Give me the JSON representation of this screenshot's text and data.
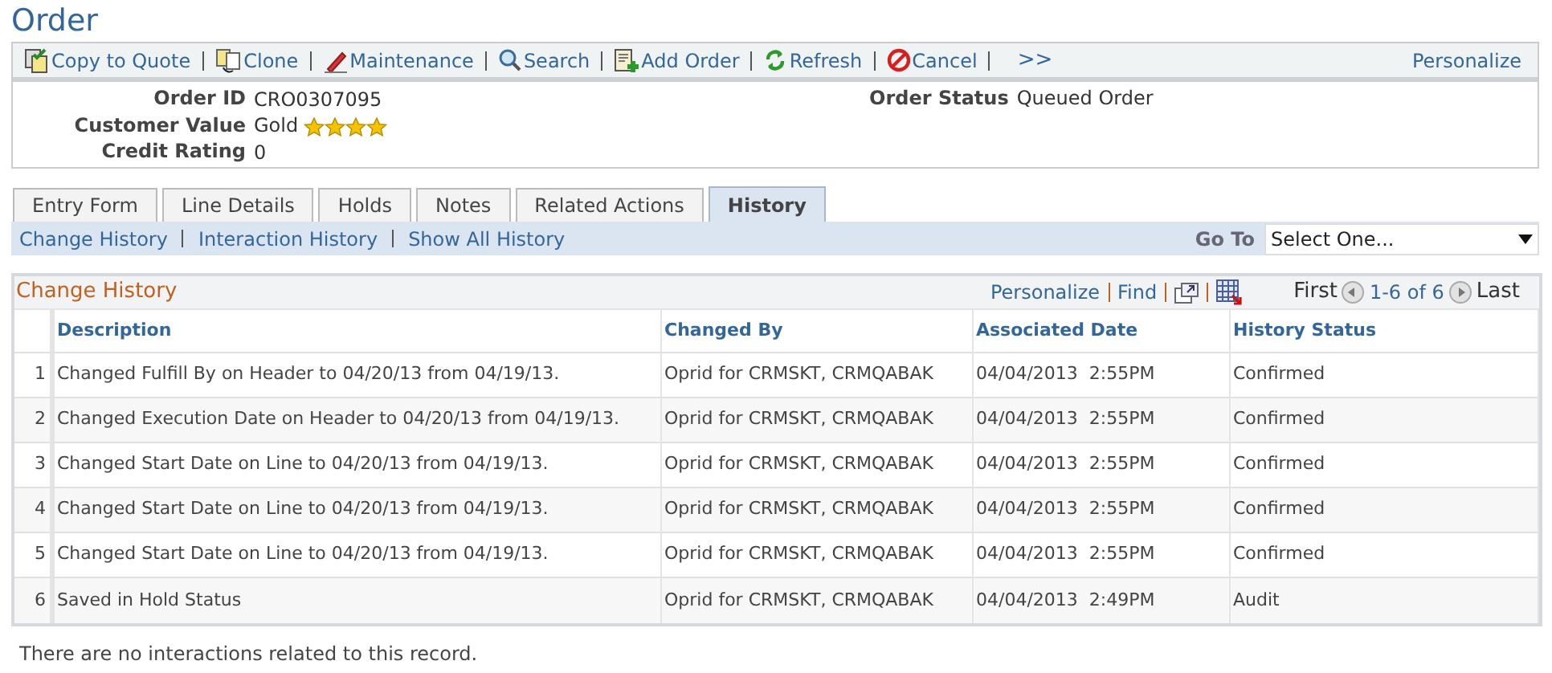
{
  "page_title": "Order",
  "toolbar": {
    "actions": [
      {
        "kind": "copy",
        "label": "Copy to Quote"
      },
      {
        "kind": "clone",
        "label": "Clone"
      },
      {
        "kind": "pencil",
        "label": "Maintenance"
      },
      {
        "kind": "search",
        "label": "Search"
      },
      {
        "kind": "add",
        "label": "Add Order"
      },
      {
        "kind": "refresh",
        "label": "Refresh"
      },
      {
        "kind": "cancel",
        "label": "Cancel"
      }
    ],
    "more": ">>",
    "personalize": "Personalize"
  },
  "summary": {
    "fields": [
      {
        "label": "Order ID",
        "value": "CRO0307095"
      },
      {
        "label": "Customer Value",
        "value": "Gold",
        "stars": 4
      },
      {
        "label": "Credit Rating",
        "value": "0"
      }
    ],
    "order_status": {
      "label": "Order Status",
      "value": "Queued Order"
    }
  },
  "tabs": [
    {
      "label": "Entry Form",
      "selected": false
    },
    {
      "label": "Line Details",
      "selected": false
    },
    {
      "label": "Holds",
      "selected": false
    },
    {
      "label": "Notes",
      "selected": false
    },
    {
      "label": "Related Actions",
      "selected": false
    },
    {
      "label": "History",
      "selected": true
    }
  ],
  "sub_links": [
    "Change History",
    "Interaction History",
    "Show All History"
  ],
  "goto": {
    "label": "Go To",
    "value": "Select One..."
  },
  "grid": {
    "title": "Change History",
    "personalize": "Personalize",
    "find": "Find",
    "first": "First",
    "range": "1-6 of 6",
    "last": "Last",
    "columns": [
      "Description",
      "Changed By",
      "Associated Date",
      "History Status"
    ],
    "rows": [
      {
        "number": "1",
        "description": "Changed Fulfill By on Header to 04/20/13 from 04/19/13.",
        "changed_by": "Oprid for CRMSKT, CRMQABAK",
        "date": "04/04/2013  2:55PM",
        "status": "Confirmed"
      },
      {
        "number": "2",
        "description": "Changed Execution Date on Header to 04/20/13 from 04/19/13.",
        "changed_by": "Oprid for CRMSKT, CRMQABAK",
        "date": "04/04/2013  2:55PM",
        "status": "Confirmed"
      },
      {
        "number": "3",
        "description": "Changed Start Date on Line to 04/20/13 from 04/19/13.",
        "changed_by": "Oprid for CRMSKT, CRMQABAK",
        "date": "04/04/2013  2:55PM",
        "status": "Confirmed"
      },
      {
        "number": "4",
        "description": "Changed Start Date on Line to 04/20/13 from 04/19/13.",
        "changed_by": "Oprid for CRMSKT, CRMQABAK",
        "date": "04/04/2013  2:55PM",
        "status": "Confirmed"
      },
      {
        "number": "5",
        "description": "Changed Start Date on Line to 04/20/13 from 04/19/13.",
        "changed_by": "Oprid for CRMSKT, CRMQABAK",
        "date": "04/04/2013  2:55PM",
        "status": "Confirmed"
      },
      {
        "number": "6",
        "description": "Saved in Hold Status",
        "changed_by": "Oprid for CRMSKT, CRMQABAK",
        "date": "04/04/2013  2:49PM",
        "status": "Audit"
      }
    ]
  },
  "footer_message": "There are no interactions related to this record."
}
